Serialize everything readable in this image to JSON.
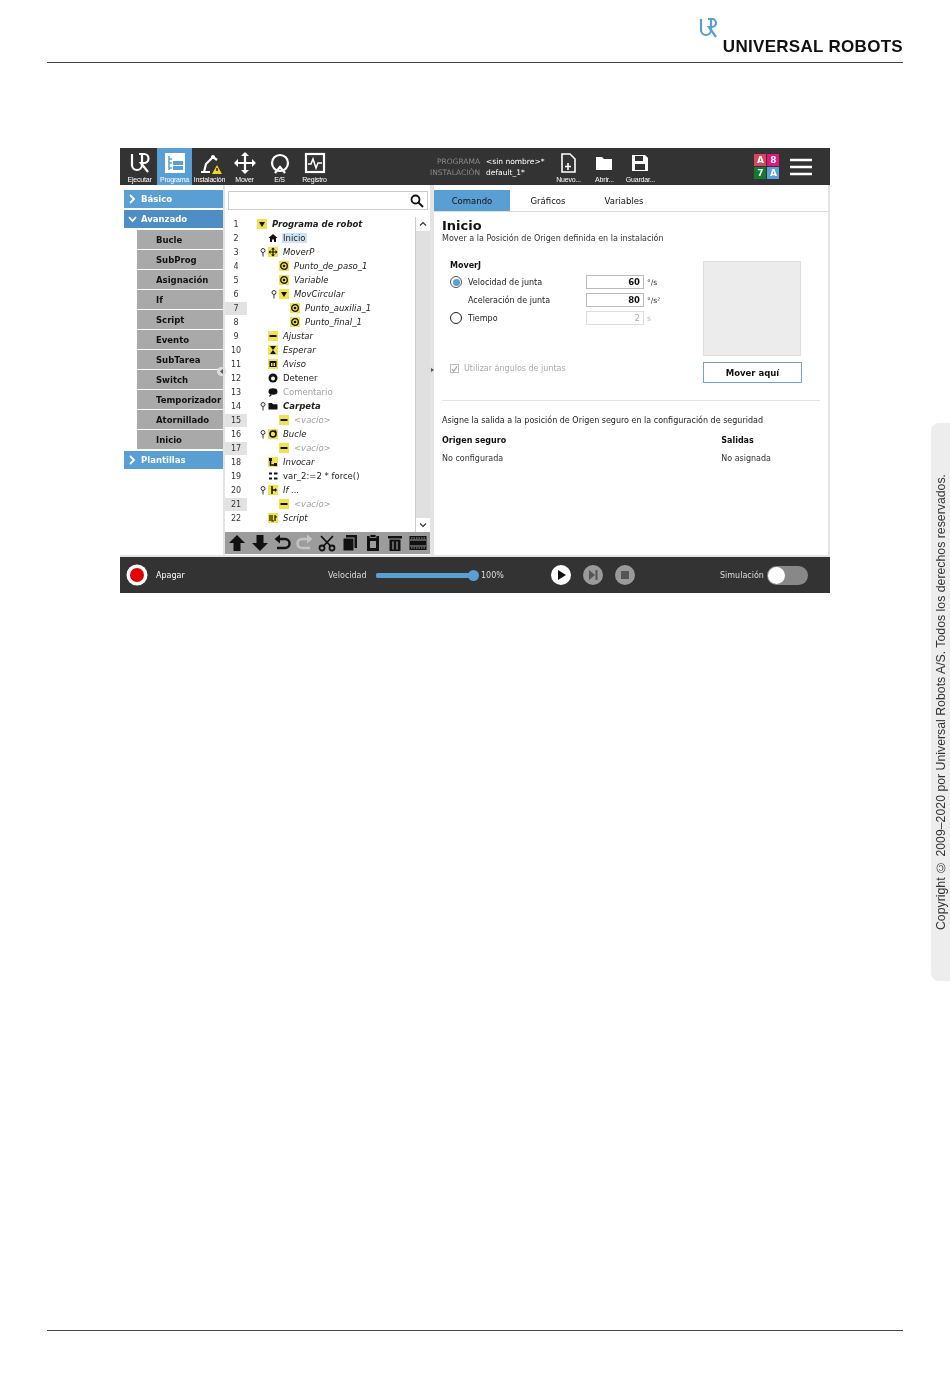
{
  "header": {
    "brand": "UNIVERSAL ROBOTS"
  },
  "top_bar": {
    "nav": [
      {
        "kind": "run",
        "label": "Ejecutar",
        "selected": false
      },
      {
        "kind": "program",
        "label": "Programa",
        "selected": true
      },
      {
        "kind": "installation",
        "label": "Instalación",
        "selected": false
      },
      {
        "kind": "move",
        "label": "Mover",
        "selected": false
      },
      {
        "kind": "io",
        "label": "E/S",
        "selected": false
      },
      {
        "kind": "log",
        "label": "Registro",
        "selected": false
      }
    ],
    "program_label": "PROGRAMA",
    "program_name": "<sin nombre>*",
    "installation_label": "INSTALACIÓN",
    "installation_name": "default_1*",
    "files": [
      {
        "kind": "new",
        "label": "Nuevo..."
      },
      {
        "kind": "open",
        "label": "Abrir..."
      },
      {
        "kind": "save",
        "label": "Guardar..."
      }
    ],
    "safety": [
      {
        "text": "A",
        "color": "#d9455f"
      },
      {
        "text": "8",
        "color": "#e5177e"
      },
      {
        "text": "7",
        "color": "#137a32"
      },
      {
        "text": "A",
        "color": "#5b9fdc"
      }
    ]
  },
  "sidebar": [
    {
      "label": "Básico",
      "expanded": false
    },
    {
      "label": "Avanzado",
      "expanded": true,
      "children": [
        {
          "label": "Bucle"
        },
        {
          "label": "SubProg"
        },
        {
          "label": "Asignación"
        },
        {
          "label": "If"
        },
        {
          "label": "Script"
        },
        {
          "label": "Evento"
        },
        {
          "label": "SubTarea"
        },
        {
          "label": "Switch"
        },
        {
          "label": "Temporizador"
        },
        {
          "label": "Atornillado"
        },
        {
          "label": "Inicio"
        }
      ]
    },
    {
      "label": "Plantillas",
      "expanded": false
    }
  ],
  "tree": [
    {
      "line": "1",
      "label": "Programa de robot",
      "kind": "program",
      "selected": false,
      "marked": false,
      "children": [
        {
          "line": "2",
          "label": "Inicio",
          "kind": "home",
          "selected": true,
          "marked": false
        },
        {
          "line": "3",
          "label": "MoverP",
          "kind": "move",
          "selected": false,
          "marked": false,
          "expanded": true,
          "children": [
            {
              "line": "4",
              "label": "Punto_de_paso_1",
              "kind": "waypoint",
              "selected": false,
              "marked": false
            },
            {
              "line": "5",
              "label": "Variable",
              "kind": "waypoint",
              "selected": false,
              "marked": false
            },
            {
              "line": "6",
              "label": "MovCircular",
              "kind": "circular",
              "selected": false,
              "marked": false,
              "expanded": true,
              "children": [
                {
                  "line": "7",
                  "label": "Punto_auxilia_1",
                  "kind": "waypoint",
                  "selected": false,
                  "marked": true
                },
                {
                  "line": "8",
                  "label": "Punto_final_1",
                  "kind": "waypoint",
                  "selected": false,
                  "marked": false
                }
              ]
            }
          ]
        },
        {
          "line": "9",
          "label": "Ajustar",
          "kind": "set",
          "selected": false,
          "marked": false
        },
        {
          "line": "10",
          "label": "Esperar",
          "kind": "wait",
          "selected": false,
          "marked": false
        },
        {
          "line": "11",
          "label": "Aviso",
          "kind": "popup",
          "selected": false,
          "marked": false
        },
        {
          "line": "12",
          "label": "Detener",
          "kind": "halt",
          "selected": false,
          "marked": false
        },
        {
          "line": "13",
          "label": "Comentario",
          "kind": "comment",
          "selected": false,
          "marked": false
        },
        {
          "line": "14",
          "label": "Carpeta",
          "kind": "folder",
          "selected": false,
          "marked": false,
          "expanded": true,
          "children": [
            {
              "line": "15",
              "label": "<vacío>",
              "kind": "empty",
              "selected": false,
              "marked": true
            }
          ]
        },
        {
          "line": "16",
          "label": "Bucle",
          "kind": "loop",
          "selected": false,
          "marked": false,
          "expanded": true,
          "children": [
            {
              "line": "17",
              "label": "<vacío>",
              "kind": "empty",
              "selected": false,
              "marked": true
            }
          ]
        },
        {
          "line": "18",
          "label": "Invocar",
          "kind": "call",
          "selected": false,
          "marked": false
        },
        {
          "line": "19",
          "label": "var_2:=2 * force()",
          "kind": "assign",
          "selected": false,
          "marked": false
        },
        {
          "line": "20",
          "label": "If ...",
          "kind": "if",
          "selected": false,
          "marked": false,
          "expanded": true,
          "children": [
            {
              "line": "21",
              "label": "<vacío>",
              "kind": "empty",
              "selected": false,
              "marked": true
            }
          ]
        },
        {
          "line": "22",
          "label": "Script",
          "kind": "script",
          "selected": false,
          "marked": false
        }
      ]
    }
  ],
  "tree_tools": [
    {
      "kind": "up",
      "disabled": false
    },
    {
      "kind": "down",
      "disabled": false
    },
    {
      "kind": "undo",
      "disabled": false
    },
    {
      "kind": "redo",
      "disabled": true
    },
    {
      "kind": "cut",
      "disabled": false
    },
    {
      "kind": "copy",
      "disabled": false
    },
    {
      "kind": "paste",
      "disabled": false
    },
    {
      "kind": "delete",
      "disabled": false
    },
    {
      "kind": "suppress",
      "disabled": false
    }
  ],
  "tabs": [
    {
      "label": "Comando",
      "selected": true
    },
    {
      "label": "Gráficos",
      "selected": false
    },
    {
      "label": "Variables",
      "selected": false
    }
  ],
  "command": {
    "title": "Inicio",
    "description": "Mover a la Posición de Origen definida en la instalación",
    "section": "MoverJ",
    "options": [
      {
        "kind": "radio",
        "label": "Velocidad de junta",
        "selected": true,
        "value": "60",
        "unit": "°/s",
        "disabled": false
      },
      {
        "kind": "plain",
        "label": "Aceleración de junta",
        "value": "80",
        "unit": "°/s²",
        "disabled": false
      },
      {
        "kind": "radio",
        "label": "Tiempo",
        "selected": false,
        "value": "2",
        "unit": "s",
        "disabled": true
      }
    ],
    "move_button": "Mover aquí",
    "joint_angles": {
      "label": "Utilizar ángulos de juntas",
      "checked": true,
      "disabled": true
    },
    "note": "Asigne la salida a la posición de Origen seguro en la configuración de seguridad",
    "columns": [
      "Origen seguro",
      "Salidas"
    ],
    "values": [
      "No configurada",
      "No asignada"
    ]
  },
  "bottom_bar": {
    "power": "Apagar",
    "speed_label": "Velocidad",
    "speed": {
      "level": 1
    },
    "speed_reading": "100%",
    "controls": [
      {
        "kind": "play",
        "disabled": false
      },
      {
        "kind": "step",
        "disabled": true
      },
      {
        "kind": "stop",
        "disabled": true
      }
    ],
    "simulation": {
      "label": "Simulación",
      "on": false
    }
  },
  "copyright": "Copyright © 2009–2020 por Universal Robots A/S. Todos los derechos reservados."
}
